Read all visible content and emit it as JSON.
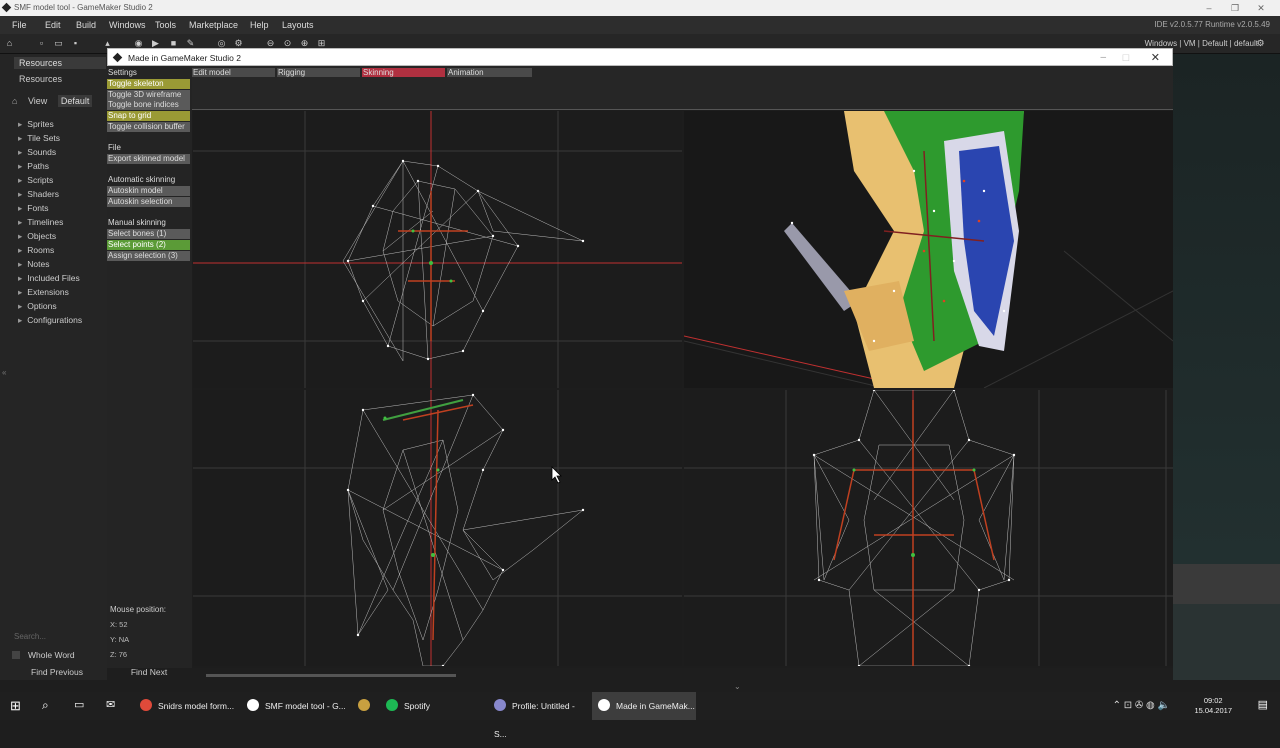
{
  "ide": {
    "title": "SMF model tool - GameMaker Studio 2",
    "menu": [
      "File",
      "Edit",
      "Build",
      "Windows",
      "Tools",
      "Marketplace",
      "Help",
      "Layouts"
    ],
    "version": "IDE v2.0.5.77  Runtime v2.0.5.49",
    "targets": "Windows | VM | Default | default",
    "resources_tab": "Resources",
    "resources_tab2": "Resources",
    "view_label": "View",
    "view_value": "Default",
    "resource_items": [
      "Sprites",
      "Tile Sets",
      "Sounds",
      "Paths",
      "Scripts",
      "Shaders",
      "Fonts",
      "Timelines",
      "Objects",
      "Rooms",
      "Notes",
      "Included Files",
      "Extensions",
      "Options",
      "Configurations"
    ],
    "search_placeholder": "Search...",
    "whole_word": "Whole Word",
    "find_previous": "Find Previous",
    "find_next": "Find Next"
  },
  "game_window": {
    "title": "Made in GameMaker Studio 2",
    "tabs": [
      {
        "label": "Edit model",
        "color": "#4a4a4a"
      },
      {
        "label": "Rigging",
        "color": "#4a4a4a"
      },
      {
        "label": "Skinning",
        "color": "#b03040"
      },
      {
        "label": "Animation",
        "color": "#4a4a4a"
      }
    ],
    "sidebar": [
      {
        "label": "Settings",
        "style": "hdr"
      },
      {
        "label": "Toggle skeleton",
        "style": "olive"
      },
      {
        "label": "Toggle 3D wireframe",
        "style": "gray"
      },
      {
        "label": "Toggle bone indices",
        "style": "gray"
      },
      {
        "label": "Snap to grid",
        "style": "olive"
      },
      {
        "label": "Toggle collision buffer",
        "style": "gray"
      },
      {
        "label": "",
        "style": "spacer"
      },
      {
        "label": "File",
        "style": "hdr"
      },
      {
        "label": "Export skinned model",
        "style": "gray"
      },
      {
        "label": "",
        "style": "spacer"
      },
      {
        "label": "Automatic skinning",
        "style": "hdr"
      },
      {
        "label": "Autoskin model",
        "style": "gray"
      },
      {
        "label": "Autoskin selection",
        "style": "gray"
      },
      {
        "label": "",
        "style": "spacer"
      },
      {
        "label": "Manual skinning",
        "style": "hdr"
      },
      {
        "label": "Select bones (1)",
        "style": "gray"
      },
      {
        "label": "Select points (2)",
        "style": "green"
      },
      {
        "label": "Assign selection (3)",
        "style": "gray"
      }
    ],
    "mouse_position_label": "Mouse position:",
    "coords": [
      "X: 52",
      "Y: NA",
      "Z: 76"
    ]
  },
  "taskbar": {
    "items": [
      {
        "label": "Snidrs model form...",
        "icon_color": "#e04a3a"
      },
      {
        "label": "SMF model tool - G...",
        "icon_color": "#ffffff"
      },
      {
        "label": "",
        "icon_color": "#c8a040"
      },
      {
        "label": "Spotify",
        "icon_color": "#1db954"
      },
      {
        "label": "Profile: Untitled - S...",
        "icon_color": "#8888cc"
      },
      {
        "label": "Made in GameMak...",
        "icon_color": "#ffffff"
      }
    ],
    "time": "09:02",
    "date": "15.04.2017"
  }
}
